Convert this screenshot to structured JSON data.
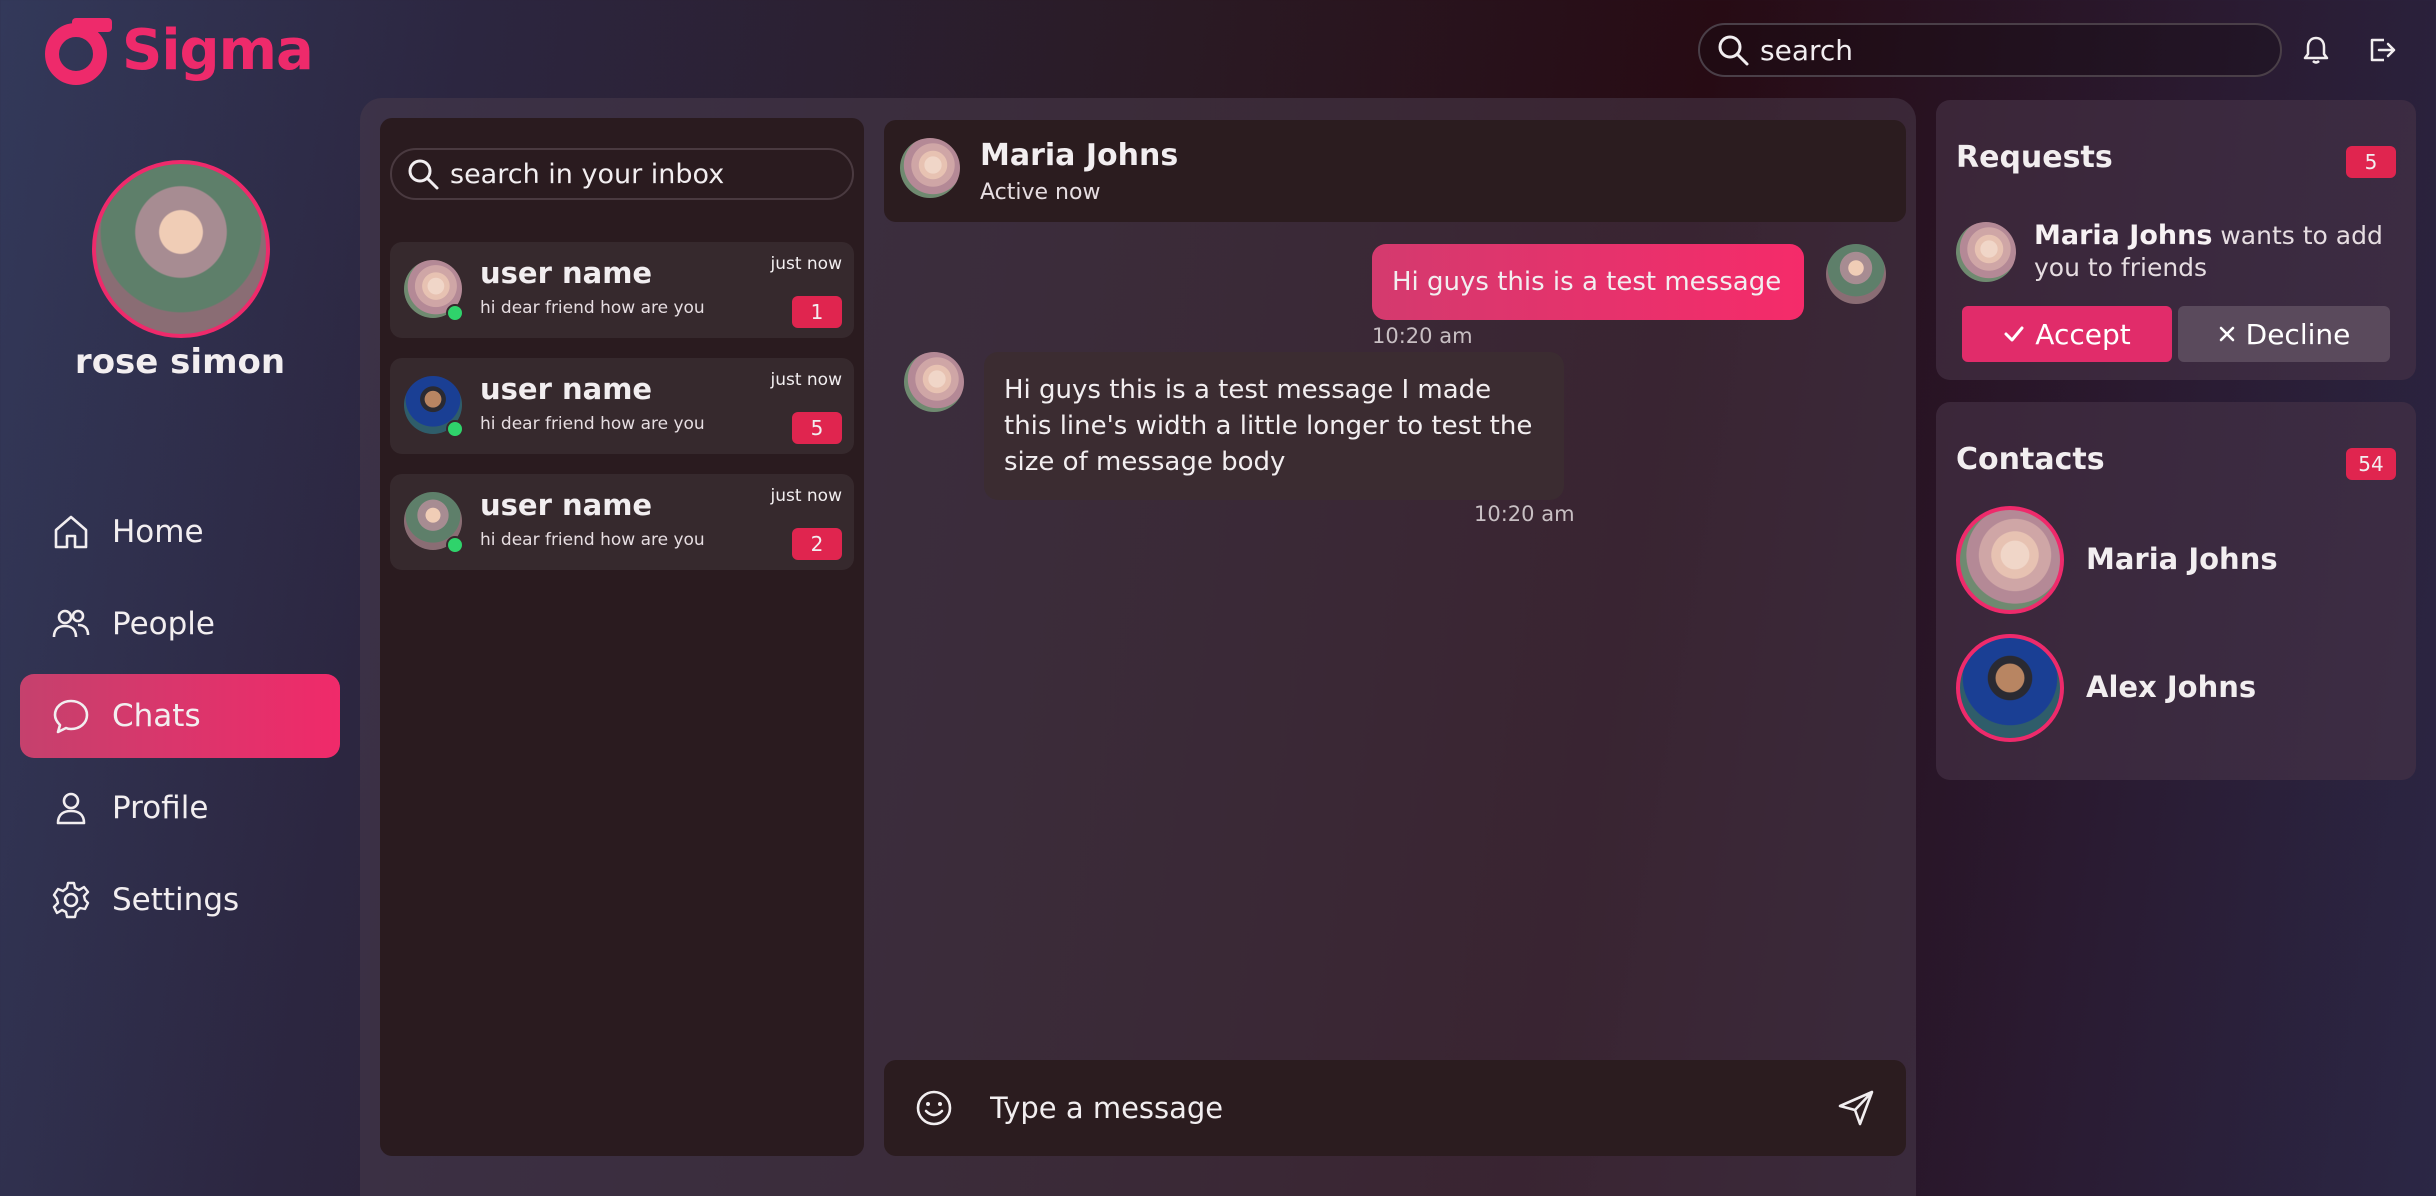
{
  "app": {
    "name": "Sigma",
    "brand_color": "#ee2a6b"
  },
  "topbar": {
    "search_placeholder": "search",
    "icons": [
      "search-icon",
      "bell-icon",
      "logout-icon"
    ]
  },
  "user": {
    "name": "rose simon"
  },
  "nav": {
    "items": [
      {
        "label": "Home",
        "icon": "home-icon",
        "active": false
      },
      {
        "label": "People",
        "icon": "people-icon",
        "active": false
      },
      {
        "label": "Chats",
        "icon": "chat-icon",
        "active": true
      },
      {
        "label": "Profile",
        "icon": "profile-icon",
        "active": false
      },
      {
        "label": "Settings",
        "icon": "gear-icon",
        "active": false
      }
    ]
  },
  "inbox": {
    "search_placeholder": "search in your inbox",
    "conversations": [
      {
        "name": "user name",
        "preview": "hi dear friend how are you",
        "time": "just now",
        "unread": "1"
      },
      {
        "name": "user name",
        "preview": "hi dear friend how are you",
        "time": "just now",
        "unread": "5"
      },
      {
        "name": "user name",
        "preview": "hi dear friend how are you",
        "time": "just now",
        "unread": "2"
      }
    ]
  },
  "chat": {
    "contact_name": "Maria Johns",
    "status": "Active now",
    "messages": [
      {
        "direction": "out",
        "text": "Hi guys this is a test message",
        "time": "10:20 am"
      },
      {
        "direction": "in",
        "text": "Hi guys this is a test message I made this line's width a little longer to test the size of message body",
        "time": "10:20 am"
      }
    ],
    "composer_placeholder": "Type a message"
  },
  "requests": {
    "title": "Requests",
    "count": "5",
    "items": [
      {
        "name": "Maria Johns",
        "text": " wants to add you to friends",
        "accept_label": "Accept",
        "decline_label": "Decline"
      }
    ]
  },
  "contacts": {
    "title": "Contacts",
    "count": "54",
    "items": [
      {
        "name": "Maria Johns"
      },
      {
        "name": "Alex Johns"
      }
    ]
  }
}
